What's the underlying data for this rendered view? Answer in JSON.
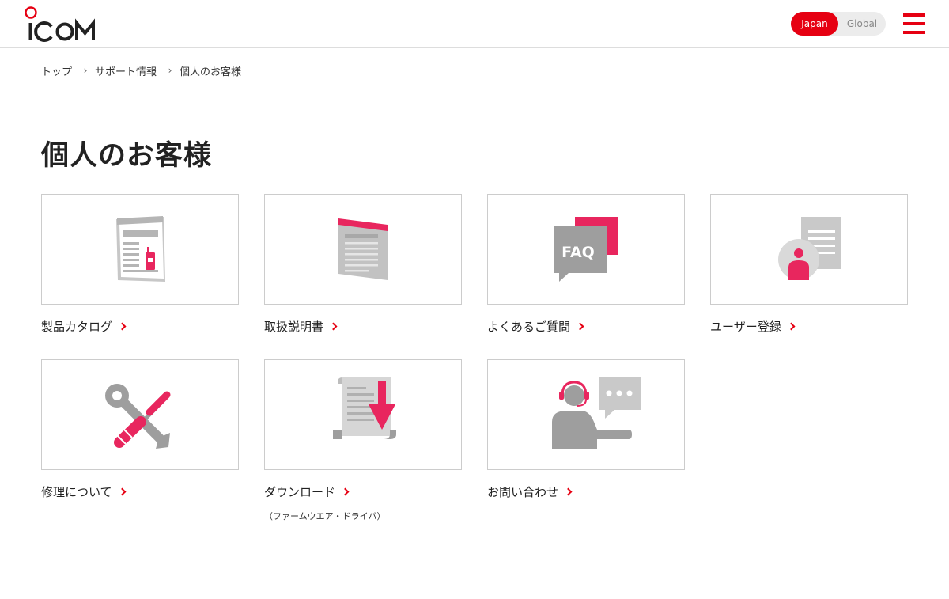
{
  "header": {
    "logo_text": "ICOM",
    "lang": {
      "japan": "Japan",
      "global": "Global"
    }
  },
  "breadcrumb": {
    "top": "トップ",
    "support": "サポート情報",
    "current": "個人のお客様"
  },
  "page_title": "個人のお客様",
  "cards": [
    {
      "label": "製品カタログ",
      "icon": "catalog-icon"
    },
    {
      "label": "取扱説明書",
      "icon": "manual-icon"
    },
    {
      "label": "よくあるご質問",
      "icon": "faq-icon",
      "icon_text": "FAQ"
    },
    {
      "label": "ユーザー登録",
      "icon": "user-registration-icon"
    },
    {
      "label": "修理について",
      "icon": "repair-tools-icon"
    },
    {
      "label": "ダウンロード",
      "sub": "（ファームウエア・ドライバ）",
      "icon": "download-icon"
    },
    {
      "label": "お問い合わせ",
      "icon": "support-operator-icon"
    }
  ],
  "colors": {
    "accent": "#e60012",
    "icon_pink": "#e8265e",
    "icon_gray": "#9e9e9e"
  }
}
